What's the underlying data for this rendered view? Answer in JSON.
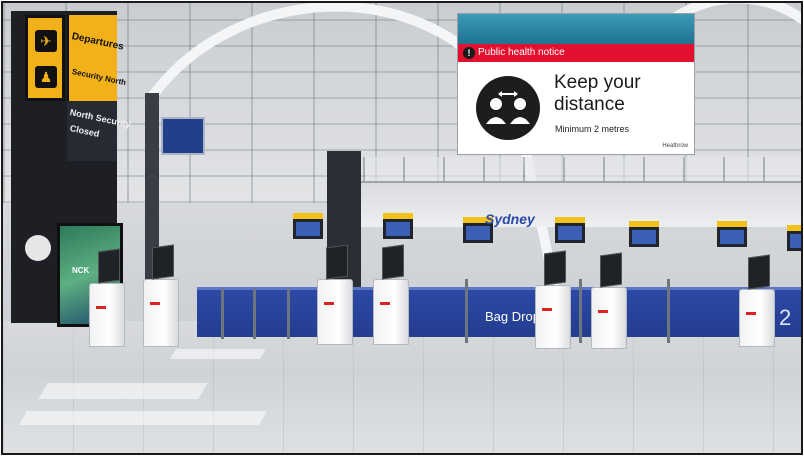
{
  "tower": {
    "line1": "Departures",
    "line2": "Security North",
    "line3": "North Security",
    "line4": "Closed",
    "ad_text": "NCK"
  },
  "notice": {
    "header": "Public health notice",
    "title": "Keep your distance",
    "subtitle": "Minimum 2 metres",
    "logo": "Heathrow"
  },
  "counter": {
    "sign": "Bag Drop",
    "number": "2",
    "airline_sign": "Sydney"
  },
  "colors": {
    "notice_red": "#e2112f",
    "counter_blue": "#2c49a6",
    "sign_yellow": "#f2b019"
  }
}
